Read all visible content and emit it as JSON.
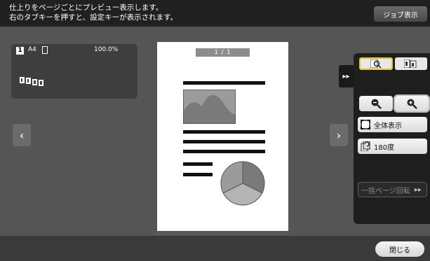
{
  "header": {
    "message_line1": "仕上りをページごとにプレビュー表示します。",
    "message_line2": "右のタブキーを押すと、設定キーが表示されます。",
    "job_button": "ジョブ表示"
  },
  "info_card": {
    "page_number": "1",
    "paper_size": "A4",
    "zoom": "100.0%"
  },
  "preview": {
    "page_indicator": "1 / 1"
  },
  "side_panel": {
    "fit_label": "全体表示",
    "rotate_label": "180度",
    "rotate_all_label": "一括ページ回転"
  },
  "footer": {
    "close_label": "閉じる"
  },
  "colors": {
    "accent_border": "#e6c417",
    "panel_bg": "#1e1e1e",
    "topbar_bg": "#202020"
  }
}
